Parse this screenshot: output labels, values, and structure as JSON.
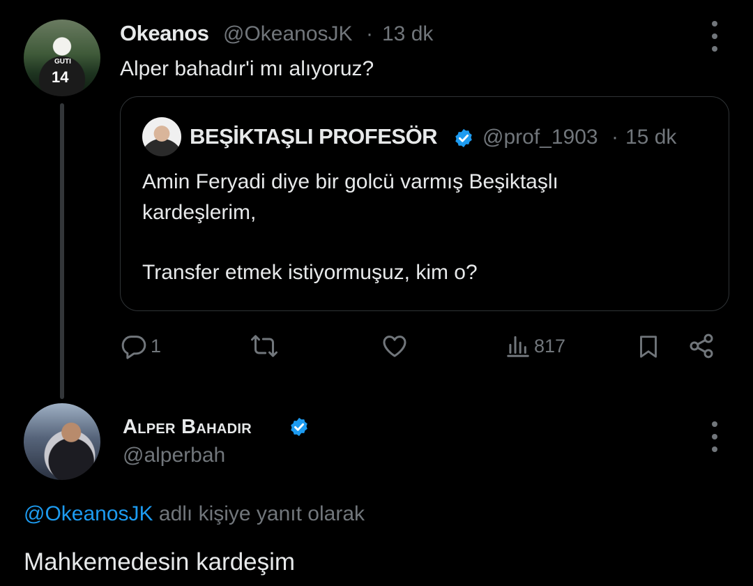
{
  "tweet": {
    "author_name": "Okeanos",
    "handle": "@OkeanosJK",
    "separator": "·",
    "time": "13 dk",
    "avatar_label_name": "GUTI",
    "avatar_label_number": "14",
    "text": "Alper bahadır'i mı alıyoruz?",
    "quote": {
      "author_name": "BEŞİKTAŞLI PROFESÖR",
      "handle": "@prof_1903",
      "separator": "·",
      "time": "15 dk",
      "line1": "Amin Feryadi diye bir golcü varmış Beşiktaşlı",
      "line2": "kardeşlerim,",
      "line3": "Transfer etmek istiyormuşuz, kim o?"
    },
    "actions": {
      "reply_count": "1",
      "views_count": "817"
    }
  },
  "reply": {
    "author_name": "Alper Bahadır",
    "handle": "@alperbah",
    "reply_mention": "@OkeanosJK",
    "reply_suffix": " adlı kişiye yanıt olarak",
    "text": "Mahkemedesin kardeşim"
  },
  "colors": {
    "background": "#000000",
    "text": "#e7e9ea",
    "muted": "#71767b",
    "accent": "#1d9bf0",
    "border": "#2f3336"
  },
  "icons": [
    "more-icon",
    "verified-icon",
    "reply-icon",
    "retweet-icon",
    "like-icon",
    "views-icon",
    "bookmark-icon",
    "share-icon"
  ]
}
